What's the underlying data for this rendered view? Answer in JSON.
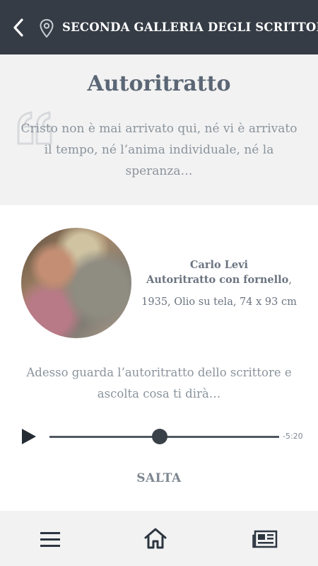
{
  "header": {
    "title": "SECONDA GALLERIA DEGLI SCRITTORI",
    "back_icon": "chevron-left-icon",
    "location_icon": "map-pin-icon"
  },
  "intro": {
    "title": "Autoritratto",
    "quote_icon": "quote-icon",
    "quote": "Cristo non è mai arrivato qui, né vi è arrivato il tempo, né l’anima individuale, né la speranza…"
  },
  "artwork": {
    "author": "Carlo Levi",
    "title": "Autoritratto con fornello",
    "title_suffix": ",",
    "details": "1935, Olio su tela, 74 x 93 cm"
  },
  "instruction": "Adesso guarda l’autoritratto dello scrittore e ascolta cosa ti dirà…",
  "player": {
    "remaining_time": "-5:20",
    "progress": 0.48,
    "play_icon": "play-icon"
  },
  "skip_label": "SALTA",
  "bottom_nav": {
    "menu_icon": "hamburger-menu-icon",
    "home_icon": "home-icon",
    "news_icon": "newspaper-icon"
  },
  "colors": {
    "header_bg": "#353c45",
    "section_bg": "#f2f2f2",
    "title_text": "#5b6675",
    "muted_text": "#8a939c"
  }
}
